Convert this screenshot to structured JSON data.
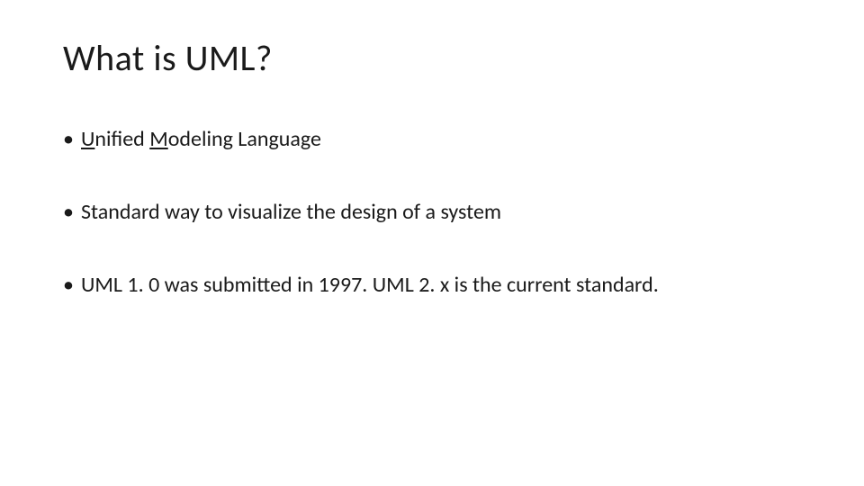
{
  "slide": {
    "title": "What is UML?",
    "bullets": [
      {
        "prefix_u": "U",
        "part1": "nified ",
        "prefix_m": "M",
        "part2": "odeling Language"
      },
      {
        "text": "Standard way to visualize the design of a system"
      },
      {
        "text": "UML 1. 0 was submitted in 1997. UML 2. x is the current standard."
      }
    ]
  }
}
